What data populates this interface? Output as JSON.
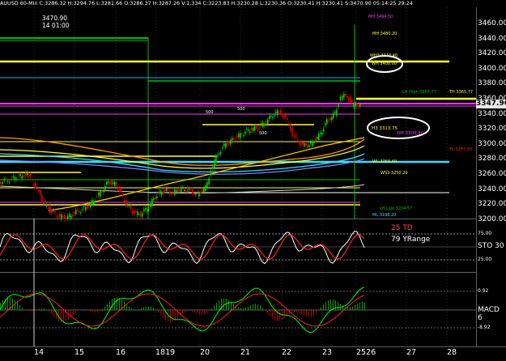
{
  "header": {
    "symbol_info": "AUUSD 60-Min C:3286.32 H:3294.76 L:3281.66 O:3286.37 H:3287.26 V:1,334 C:3223.83 H:3230.28 L:3230.36 O:3230.41 H:3230.41 S:3470.90 05:14:25 29:24"
  },
  "crosshair": {
    "price": "3470.90",
    "time": "14 01:00"
  },
  "last_price": "3347.96",
  "price_axis": [
    "3460.00",
    "3440.00",
    "3420.00",
    "3400.00",
    "3380.00",
    "3360.00",
    "3340.00",
    "3320.00",
    "3300.00",
    "3280.00",
    "3260.00",
    "3240.00",
    "3220.00",
    "3200.00"
  ],
  "date_axis": [
    "14",
    "15",
    "16",
    "1819",
    "20",
    "21",
    "22",
    "23",
    "2526",
    "27",
    "28"
  ],
  "annotations": {
    "level_500a": "500",
    "level_500b": "500",
    "level_500c": "500",
    "m_high": "MH 3480.20",
    "w_h3": "WH3 3414.40",
    "wm_high": "WH 3400.00",
    "lh_high": "LH High 3365.77",
    "th": "TH 3365.77",
    "h3": "H3 3313.75",
    "wp": "WP 3309.40",
    "tl": "TL 3287.50",
    "wl": "WL 3260.40",
    "wl3": "WS3 3250.20",
    "lh_low": "LH Low 3204.57",
    "m_low": "ML 3198.20",
    "mh_top": "MH 3494.50"
  },
  "stoch": {
    "td": "25 TD",
    "yrange": "79 YRange",
    "label": "STO 30",
    "level_75": "75.00",
    "level_25": "25.00"
  },
  "macd": {
    "label": "MACD 6",
    "level_top": "0.92",
    "level_bottom": "-8.92"
  },
  "colors": {
    "bg": "#000000",
    "up_candle": "#00d000",
    "down_candle": "#e00000",
    "yellow": "#ffff33",
    "magenta": "#ff33ff",
    "cyan": "#33e0ff",
    "orange": "#ff9900"
  }
}
